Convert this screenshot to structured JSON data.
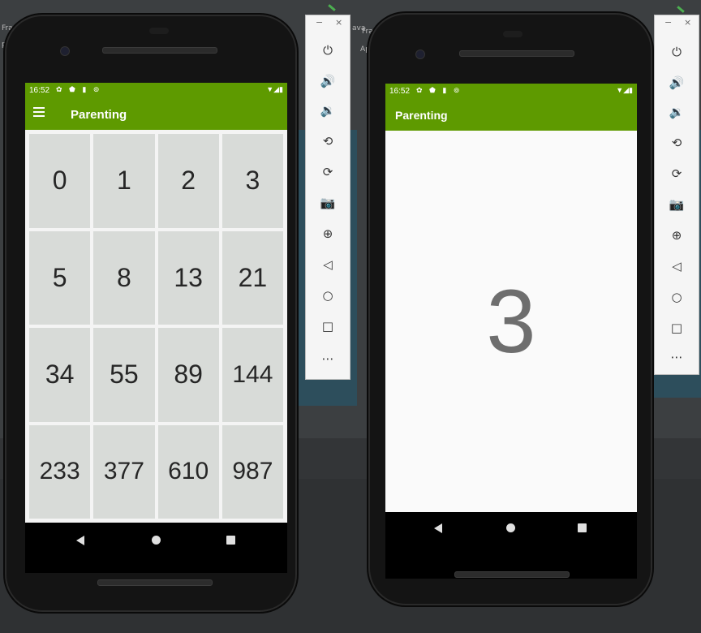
{
  "status_bar": {
    "time": "16:52",
    "left_icons": "✿ ⬟ ▮ ⊚",
    "right_icons": "▼◢▮"
  },
  "app_bar": {
    "title": "Parenting"
  },
  "ide": {
    "tab_left_a": "Frag",
    "tab_left_b": "pp",
    "tab_right_a": "ava",
    "tab_right_b": "Frag",
    "tab_right_c": "App"
  },
  "fibonacci_grid": [
    [
      "0",
      "1",
      "2",
      "3"
    ],
    [
      "5",
      "8",
      "13",
      "21"
    ],
    [
      "34",
      "55",
      "89",
      "144"
    ],
    [
      "233",
      "377",
      "610",
      "987"
    ]
  ],
  "detail": {
    "selected_value": "3"
  },
  "emulator_toolbar": {
    "minimize": "−",
    "close": "×",
    "buttons": [
      {
        "name": "power",
        "glyph": "⏻"
      },
      {
        "name": "volume-up",
        "glyph": "🔊"
      },
      {
        "name": "volume-down",
        "glyph": "🔉"
      },
      {
        "name": "rotate-left",
        "glyph": "⟲"
      },
      {
        "name": "rotate-right",
        "glyph": "⟳"
      },
      {
        "name": "screenshot",
        "glyph": "📷"
      },
      {
        "name": "zoom",
        "glyph": "⊕"
      },
      {
        "name": "back",
        "glyph": "◁"
      },
      {
        "name": "home",
        "glyph": "○"
      },
      {
        "name": "overview",
        "glyph": "□"
      },
      {
        "name": "more",
        "glyph": "⋯"
      }
    ]
  },
  "colors": {
    "app_bar": "#5e9a00",
    "tile": "#d8dbd8",
    "grid_bg": "#f4f4f4",
    "detail_number": "#6e6e6e"
  }
}
